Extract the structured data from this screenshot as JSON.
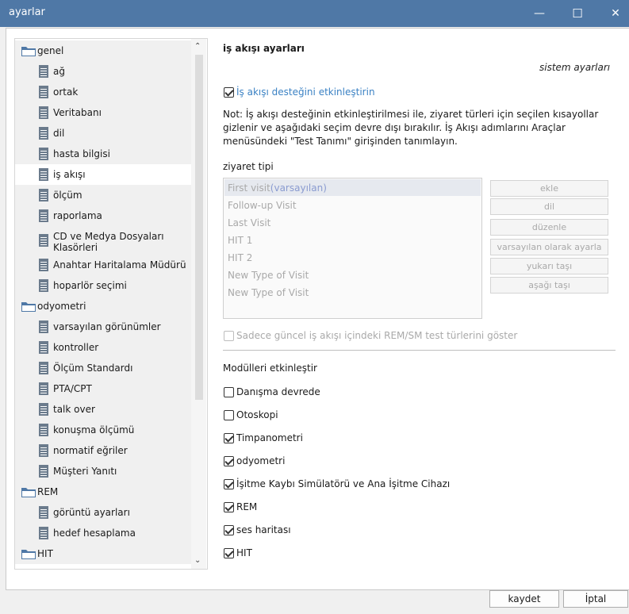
{
  "window": {
    "title": "ayarlar",
    "minimize": "—",
    "maximize": "☐",
    "close": "✕"
  },
  "sidebar": {
    "items": [
      {
        "label": "genel",
        "type": "folder",
        "level": 0
      },
      {
        "label": "ağ",
        "type": "doc",
        "level": 1
      },
      {
        "label": "ortak",
        "type": "doc",
        "level": 1
      },
      {
        "label": "Veritabanı",
        "type": "doc",
        "level": 1
      },
      {
        "label": "dil",
        "type": "doc",
        "level": 1
      },
      {
        "label": "hasta bilgisi",
        "type": "doc",
        "level": 1
      },
      {
        "label": "iş akışı",
        "type": "doc",
        "level": 1,
        "selected": true
      },
      {
        "label": "ölçüm",
        "type": "doc",
        "level": 1
      },
      {
        "label": "raporlama",
        "type": "doc",
        "level": 1
      },
      {
        "label": "CD ve Medya Dosyaları",
        "label2": "Klasörleri",
        "type": "doc",
        "level": 1
      },
      {
        "label": "Anahtar Haritalama Müdürü",
        "type": "doc",
        "level": 1
      },
      {
        "label": "hoparlör seçimi",
        "type": "doc",
        "level": 1
      },
      {
        "label": "odyometri",
        "type": "folder",
        "level": 0
      },
      {
        "label": "varsayılan görünümler",
        "type": "doc",
        "level": 1
      },
      {
        "label": "kontroller",
        "type": "doc",
        "level": 1
      },
      {
        "label": "Ölçüm Standardı",
        "type": "doc",
        "level": 1
      },
      {
        "label": "PTA/CPT",
        "type": "doc",
        "level": 1
      },
      {
        "label": "talk over",
        "type": "doc",
        "level": 1
      },
      {
        "label": "konuşma ölçümü",
        "type": "doc",
        "level": 1
      },
      {
        "label": "normatif eğriler",
        "type": "doc",
        "level": 1
      },
      {
        "label": "Müşteri Yanıtı",
        "type": "doc",
        "level": 1
      },
      {
        "label": "REM",
        "type": "folder",
        "level": 0
      },
      {
        "label": "görüntü ayarları",
        "type": "doc",
        "level": 1
      },
      {
        "label": "hedef hesaplama",
        "type": "doc",
        "level": 1
      },
      {
        "label": "HIT",
        "type": "folder",
        "level": 0
      }
    ]
  },
  "panel": {
    "title": "iş akışı ayarları",
    "system_label": "sistem ayarları",
    "workflow_checkbox": {
      "label": "İş akışı desteğini etkinleştirin",
      "checked": true
    },
    "note": "Not: İş akışı desteğinin etkinleştirilmesi ile, ziyaret türleri için seçilen kısayollar gizlenir ve aşağıdaki seçim devre dışı bırakılır. İş Akışı adımlarını Araçlar menüsündeki \"Test Tanımı\" girişinden tanımlayın.",
    "visit_type_label": "ziyaret tipi",
    "visits": [
      {
        "name": "First visit",
        "tag": "(varsayılan)"
      },
      {
        "name": "Follow-up Visit",
        "tag": ""
      },
      {
        "name": "Last Visit",
        "tag": ""
      },
      {
        "name": "HIT 1",
        "tag": ""
      },
      {
        "name": "HIT 2",
        "tag": ""
      },
      {
        "name": "New Type of Visit",
        "tag": ""
      },
      {
        "name": "New Type of Visit",
        "tag": ""
      }
    ],
    "buttons": {
      "add": "ekle",
      "language": "dil",
      "edit": "düzenle",
      "set_default": "varsayılan olarak ayarla",
      "move_up": "yukarı taşı",
      "move_down": "aşağı taşı"
    },
    "rem_sm_checkbox": {
      "label": "Sadece güncel iş akışı içindeki REM/SM test türlerini göster",
      "checked": false
    },
    "modules_label": "Modülleri etkinleştir",
    "modules": [
      {
        "label": "Danışma devrede",
        "checked": false
      },
      {
        "label": "Otoskopi",
        "checked": false
      },
      {
        "label": "Timpanometri",
        "checked": true
      },
      {
        "label": "odyometri",
        "checked": true
      },
      {
        "label": "İşitme Kaybı Simülatörü ve Ana İşitme Cihazı",
        "checked": true
      },
      {
        "label": "REM",
        "checked": true
      },
      {
        "label": "ses haritası",
        "checked": true
      },
      {
        "label": "HIT",
        "checked": true
      }
    ]
  },
  "footer": {
    "save": "kaydet",
    "cancel": "İptal"
  },
  "colors": {
    "titlebar": "#4f78a6",
    "accent": "#3b82c4",
    "folder": "#4f78a6",
    "doc_icon": "#6b7b8c"
  }
}
